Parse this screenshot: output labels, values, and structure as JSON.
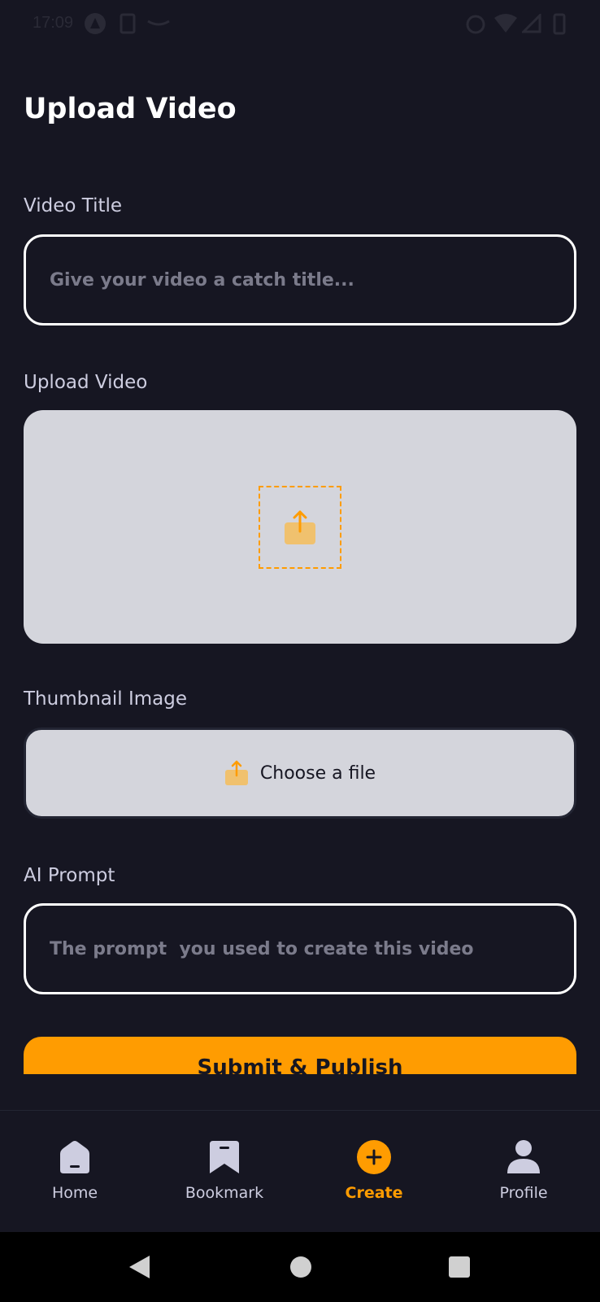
{
  "status_bar": {
    "time": "17:09"
  },
  "page": {
    "title": "Upload Video"
  },
  "form": {
    "title_label": "Video Title",
    "title_placeholder": "Give your video a catch title...",
    "video_label": "Upload Video",
    "thumbnail_label": "Thumbnail Image",
    "thumbnail_button": "Choose a file",
    "prompt_label": "AI Prompt",
    "prompt_placeholder": "The prompt  you used to create this video",
    "submit_label": "Submit & Publish"
  },
  "tabs": [
    {
      "label": "Home",
      "icon": "home-icon"
    },
    {
      "label": "Bookmark",
      "icon": "bookmark-icon"
    },
    {
      "label": "Create",
      "icon": "plus-icon",
      "active": true
    },
    {
      "label": "Profile",
      "icon": "profile-icon"
    }
  ],
  "colors": {
    "background": "#161622",
    "accent": "#FF9C01",
    "upload_area": "#D4D5DC",
    "placeholder": "#7B7B8B"
  }
}
